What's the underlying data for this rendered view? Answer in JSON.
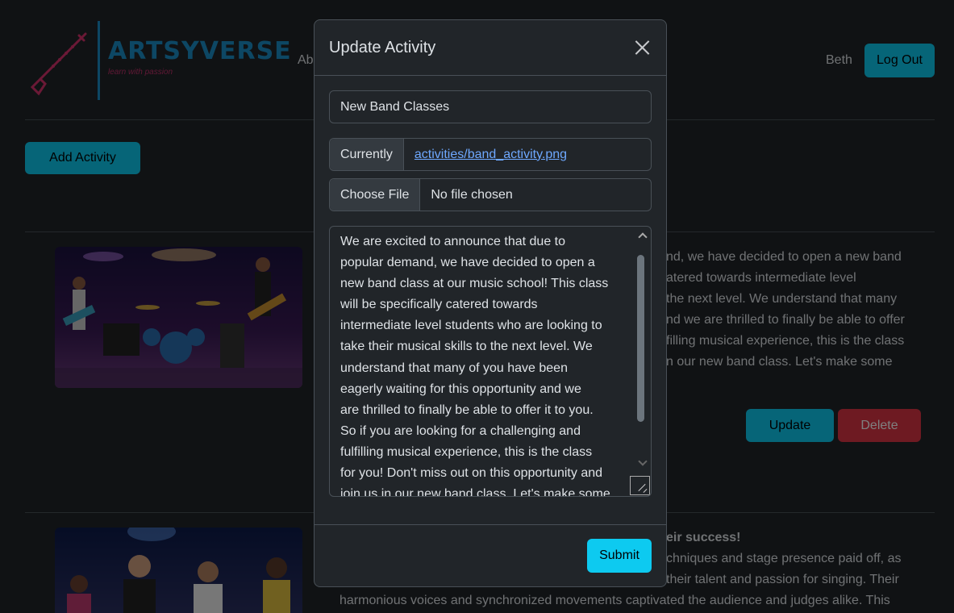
{
  "header": {
    "brand": "ARTSYVERSE",
    "tagline": "learn with passion",
    "nav_about": "Ab",
    "username": "Beth",
    "logout_label": "Log Out"
  },
  "main": {
    "add_activity_label": "Add Activity",
    "cards": [
      {
        "text_lines": [
          "nd, we have decided to open a new band",
          "atered towards intermediate level",
          "the next level. We understand that many",
          "nd we are thrilled to finally be able to offer",
          "filling musical experience, this is the class",
          "n our new band class. Let's make some"
        ],
        "update_label": "Update",
        "delete_label": "Delete"
      },
      {
        "heading_fragment": "eir success!",
        "text_lines": [
          "chniques and stage presence paid off, as",
          "their talent and passion for singing. Their",
          "harmonious voices and synchronized movements captivated the audience and judges alike. This"
        ]
      }
    ]
  },
  "modal": {
    "title": "Update Activity",
    "activity_title_value": "New Band Classes",
    "currently_label": "Currently",
    "current_file": "activities/band_activity.png",
    "choose_file_label": "Choose File",
    "no_file_text": "No file chosen",
    "description_lines": [
      "We are excited to announce that due to",
      "popular demand, we have decided to open a",
      "new band class at our music school! This class",
      "will be specifically catered towards",
      "intermediate level students who are looking to",
      "take their musical skills to the next level. We",
      "understand that many of you have been",
      "eagerly waiting for this opportunity and we",
      "are thrilled to finally be able to offer it to you.",
      "So if you are looking for a challenging and",
      "fulfilling musical experience, this is the class",
      "for you! Don't miss out on this opportunity and",
      "join us in our new band class. Let's make some"
    ],
    "submit_label": "Submit"
  }
}
